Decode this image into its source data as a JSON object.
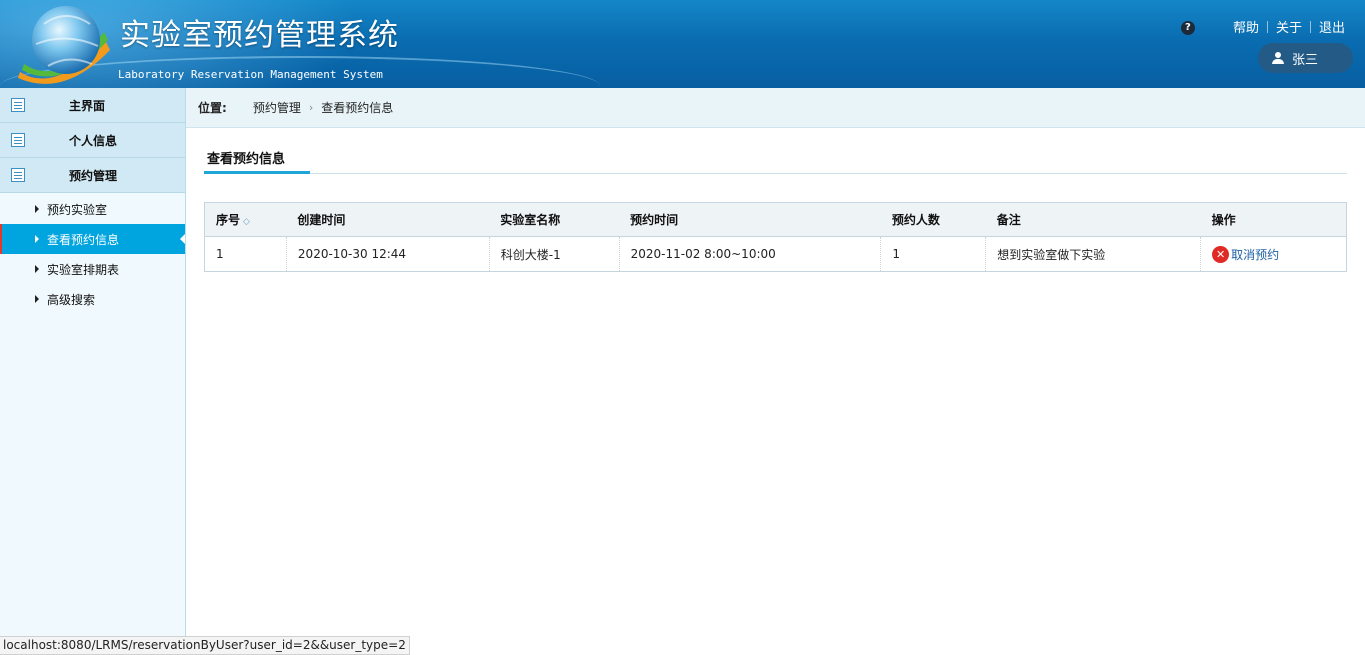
{
  "app": {
    "title": "实验室预约管理系统",
    "subtitle": "Laboratory Reservation Management System"
  },
  "top_links": {
    "help": "帮助",
    "about": "关于",
    "logout": "退出"
  },
  "user": {
    "name": "张三"
  },
  "sidebar": {
    "sections": [
      {
        "label": "主界面"
      },
      {
        "label": "个人信息"
      },
      {
        "label": "预约管理"
      }
    ],
    "items": [
      {
        "label": "预约实验室",
        "active": false
      },
      {
        "label": "查看预约信息",
        "active": true
      },
      {
        "label": "实验室排期表",
        "active": false
      },
      {
        "label": "高级搜索",
        "active": false
      }
    ]
  },
  "breadcrumb": {
    "label": "位置:",
    "parent": "预约管理",
    "current": "查看预约信息"
  },
  "tab": {
    "label": "查看预约信息"
  },
  "table": {
    "columns": [
      "序号",
      "创建时间",
      "实验室名称",
      "预约时间",
      "预约人数",
      "备注",
      "操作"
    ],
    "rows": [
      {
        "no": "1",
        "created": "2020-10-30 12:44",
        "lab": "科创大楼-1",
        "time": "2020-11-02 8:00~10:00",
        "people": "1",
        "note": "想到实验室做下实验",
        "action": "取消预约"
      }
    ]
  },
  "status_url": "localhost:8080/LRMS/reservationByUser?user_id=2&&user_type=2",
  "colors": {
    "header": "#0a6cb1",
    "active_item": "#00a5e0",
    "active_marker": "#e23a2a",
    "link": "#1d5fa5"
  }
}
